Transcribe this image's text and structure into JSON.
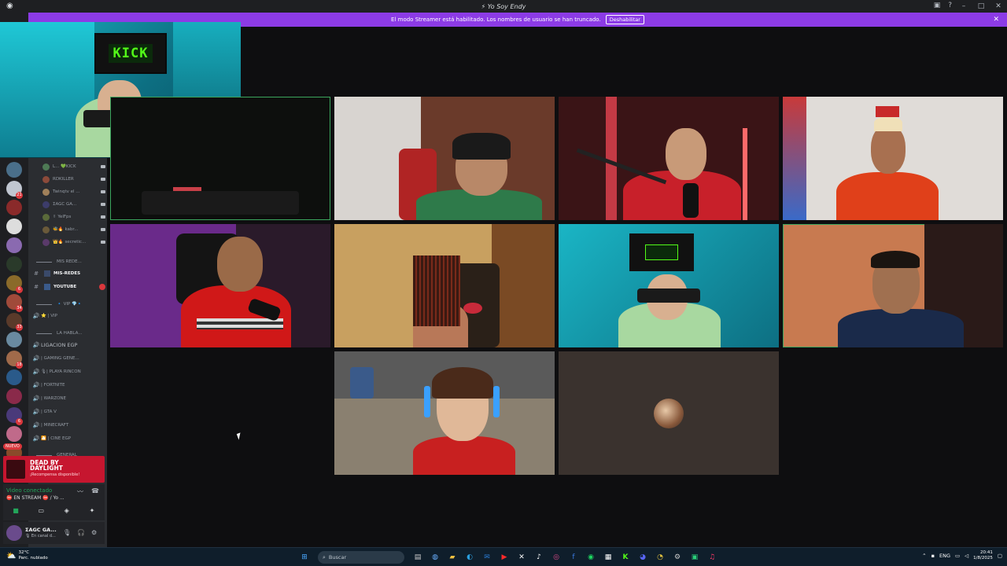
{
  "window": {
    "title": "Yo Soy Endy"
  },
  "banner": {
    "text": "El modo Streamer está habilitado. Los nombres de usuario se han truncado.",
    "button": "Deshabilitar"
  },
  "overlay": {
    "sign_text": "KICK"
  },
  "voice_users": [
    {
      "name": "L... 💚KICK",
      "color": "#4e7a55"
    },
    {
      "name": "RDKILLER",
      "color": "#8c4a3a"
    },
    {
      "name": "Twinqtv el ...",
      "color": "#a0805a"
    },
    {
      "name": "ΣAGC GA...",
      "color": "#3c3c6a"
    },
    {
      "name": "✌ YelFps",
      "color": "#5a6a3a"
    },
    {
      "name": "🐝🔥 kabr...",
      "color": "#6a5a3a"
    },
    {
      "name": "👑🔥 secretic...",
      "color": "#5a3a6a"
    }
  ],
  "channels": [
    {
      "type": "cat",
      "label": "MIS REDE..."
    },
    {
      "type": "text",
      "label": "MIS-REDES"
    },
    {
      "type": "text",
      "label": "YOUTUBE"
    },
    {
      "type": "cat",
      "label": "🔹 VIP 💎🔹"
    },
    {
      "type": "voice",
      "label": "⭐ | VIP"
    },
    {
      "type": "cat",
      "label": "LA HABLA..."
    },
    {
      "type": "voice",
      "label": "LIGACION EGP"
    },
    {
      "type": "voice",
      "label": "| GAMING GENE..."
    },
    {
      "type": "voice",
      "label": "🎙| PLAYA RINCON"
    },
    {
      "type": "voice",
      "label": "| FORTNITE"
    },
    {
      "type": "voice",
      "label": "| WARZONE"
    },
    {
      "type": "voice",
      "label": "| GTA V"
    },
    {
      "type": "voice",
      "label": "| MINECRAFT"
    },
    {
      "type": "voice",
      "label": "🎦 | CINE EGP"
    },
    {
      "type": "cat",
      "label": "GENERAL"
    }
  ],
  "server_badges": [
    "21",
    "6",
    "34",
    "33",
    "18",
    "6"
  ],
  "nuevo": "NUEVO",
  "activity": {
    "game": "DEAD BY DAYLIGHT",
    "sub": "¡Recompensa disponible!"
  },
  "voice_panel": {
    "status": "Video conectado",
    "detail": "⛔ EN STREAM ⛔ / Yo ..."
  },
  "user": {
    "name": "ΣAGC GA...",
    "status": "🎙 En canal d..."
  },
  "taskbar": {
    "weather_temp": "32°C",
    "weather_desc": "Parc. nublado",
    "search": "Buscar",
    "lang": "ENG",
    "time": "20:41",
    "date": "1/8/2025"
  }
}
